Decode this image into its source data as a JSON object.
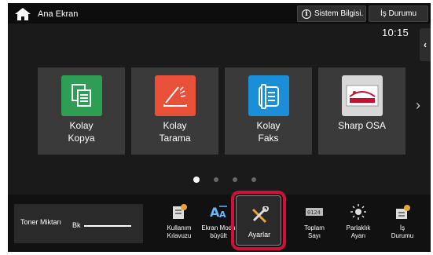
{
  "header": {
    "home_label": "Ana Ekran",
    "info_label": "Sistem Bilgisi.",
    "job_label": "İş Durumu"
  },
  "clock": "10:15",
  "side_tab_icon": "chevron-left-icon",
  "tiles": [
    {
      "line1": "Kolay",
      "line2": "Kopya",
      "color": "#2e9e55",
      "icon": "copy-icon"
    },
    {
      "line1": "Kolay",
      "line2": "Tarama",
      "color": "#e8503a",
      "icon": "scan-icon"
    },
    {
      "line1": "Kolay",
      "line2": "Faks",
      "color": "#1a8fd8",
      "icon": "fax-icon"
    },
    {
      "line1": "Sharp OSA",
      "line2": "",
      "color": "#d8d8d8",
      "icon": "osa-icon"
    }
  ],
  "pager": {
    "total": 4,
    "active": 0
  },
  "toner": {
    "label": "Toner Miktarı",
    "channel": "Bk"
  },
  "bottom_items": [
    {
      "line1": "Kullanım",
      "line2": "Kılavuzu",
      "icon": "manual-icon"
    },
    {
      "line1": "Ekran Modu",
      "line2": "büyült",
      "icon": "display-mode-icon"
    },
    {
      "line1": "Ayarlar",
      "line2": "",
      "icon": "settings-icon"
    },
    {
      "line1": "Toplam",
      "line2": "Sayı",
      "icon": "counter-icon"
    },
    {
      "line1": "Parlaklık",
      "line2": "Ayarı",
      "icon": "brightness-icon"
    },
    {
      "line1": "İş",
      "line2": "Durumu",
      "icon": "job-status-icon"
    }
  ],
  "colors": {
    "highlight": "#d0103a",
    "screen": "#1a1a1a",
    "tile": "#3a3a3a"
  }
}
